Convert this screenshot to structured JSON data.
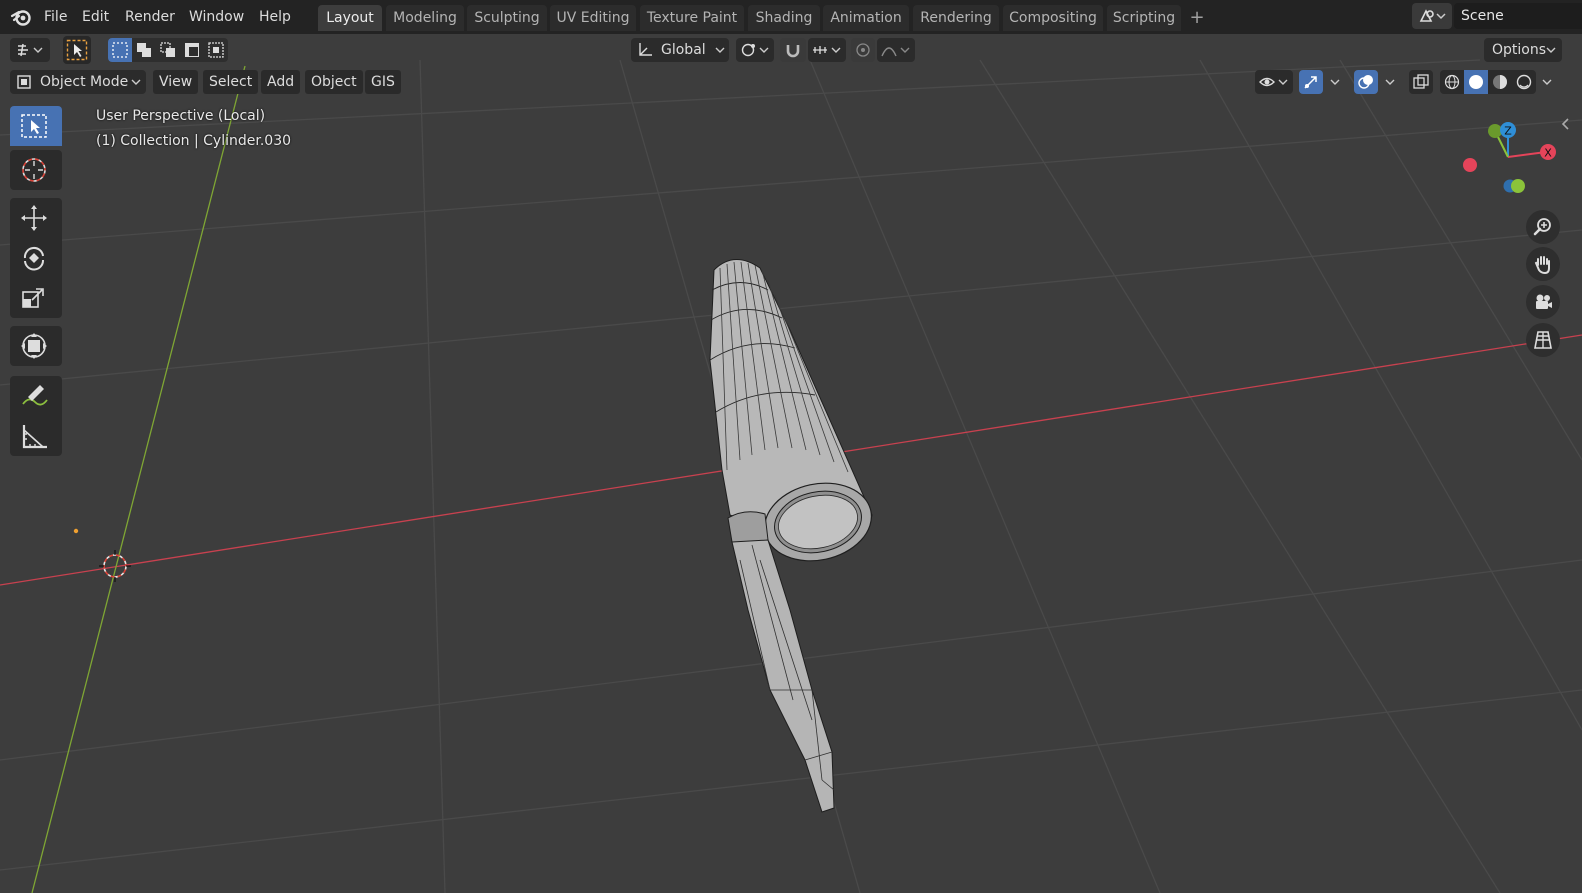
{
  "topbar": {
    "menus": [
      "File",
      "Edit",
      "Render",
      "Window",
      "Help"
    ],
    "tabs": [
      "Layout",
      "Modeling",
      "Sculpting",
      "UV Editing",
      "Texture Paint",
      "Shading",
      "Animation",
      "Rendering",
      "Compositing",
      "Scripting"
    ],
    "active_tab": "Layout",
    "add_tab_icon": "plus-icon",
    "scene_name": "Scene"
  },
  "tool_header": {
    "transform_orientation": "Global",
    "options_label": "Options"
  },
  "viewport_header": {
    "mode": "Object Mode",
    "menus": [
      "View",
      "Select",
      "Add",
      "Object",
      "GIS"
    ]
  },
  "viewport": {
    "view_name": "User Perspective (Local)",
    "context": "(1) Collection | Cylinder.030",
    "grid_color": "#4a4a4a",
    "x_axis_color": "#c8414f",
    "y_axis_color": "#7fa634",
    "background": "#3d3d3d"
  },
  "toolbar": {
    "tools": [
      "select-box-icon",
      "cursor-icon",
      "move-icon",
      "rotate-icon",
      "scale-icon",
      "transform-icon",
      "annotate-icon",
      "measure-icon"
    ],
    "active_tool": "select-box-icon"
  },
  "gizmo": {
    "axes": [
      "X",
      "Y",
      "Z"
    ],
    "colors": {
      "x": "#e5445a",
      "y": "#8bc33a",
      "z": "#2f8fd8"
    }
  },
  "navigation": [
    "zoom-icon",
    "pan-hand-icon",
    "camera-icon",
    "ortho-grid-icon"
  ],
  "accent": "#4772b3"
}
